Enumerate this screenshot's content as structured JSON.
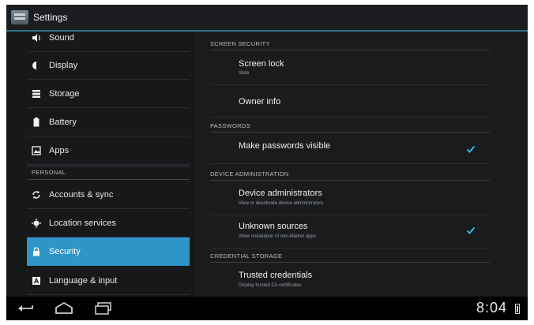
{
  "app": {
    "title": "Settings",
    "icon": "settings-icon"
  },
  "sidebar": {
    "items": [
      {
        "label": "Sound",
        "icon": "speaker-icon"
      },
      {
        "label": "Display",
        "icon": "display-brightness-icon"
      },
      {
        "label": "Storage",
        "icon": "storage-icon"
      },
      {
        "label": "Battery",
        "icon": "battery-icon"
      },
      {
        "label": "Apps",
        "icon": "apps-icon"
      },
      {
        "label": "Accounts & sync",
        "icon": "sync-icon"
      },
      {
        "label": "Location services",
        "icon": "location-icon"
      },
      {
        "label": "Security",
        "icon": "lock-icon",
        "selected": true
      },
      {
        "label": "Language & input",
        "icon": "language-icon"
      }
    ],
    "personal_header": "PERSONAL"
  },
  "content": {
    "sections": {
      "screen_security": "SCREEN SECURITY",
      "passwords": "PASSWORDS",
      "device_administration": "DEVICE ADMINISTRATION",
      "credential_storage": "CREDENTIAL STORAGE"
    },
    "screen_lock": {
      "title": "Screen lock",
      "summary": "Slide"
    },
    "owner_info": {
      "title": "Owner info"
    },
    "make_passwords_visible": {
      "title": "Make passwords visible",
      "checked": true
    },
    "device_administrators": {
      "title": "Device administrators",
      "summary": "View or deactivate device administrators"
    },
    "unknown_sources": {
      "title": "Unknown sources",
      "summary": "Allow installation of non-Market apps",
      "checked": true
    },
    "trusted_credentials": {
      "title": "Trusted credentials",
      "summary": "Display trusted CA certificates"
    }
  },
  "navbar": {
    "time": "8:04",
    "back_icon": "back-icon",
    "home_icon": "home-icon",
    "recents_icon": "recent-apps-icon"
  },
  "colors": {
    "accent": "#2e95c9",
    "check": "#33b5e5"
  }
}
